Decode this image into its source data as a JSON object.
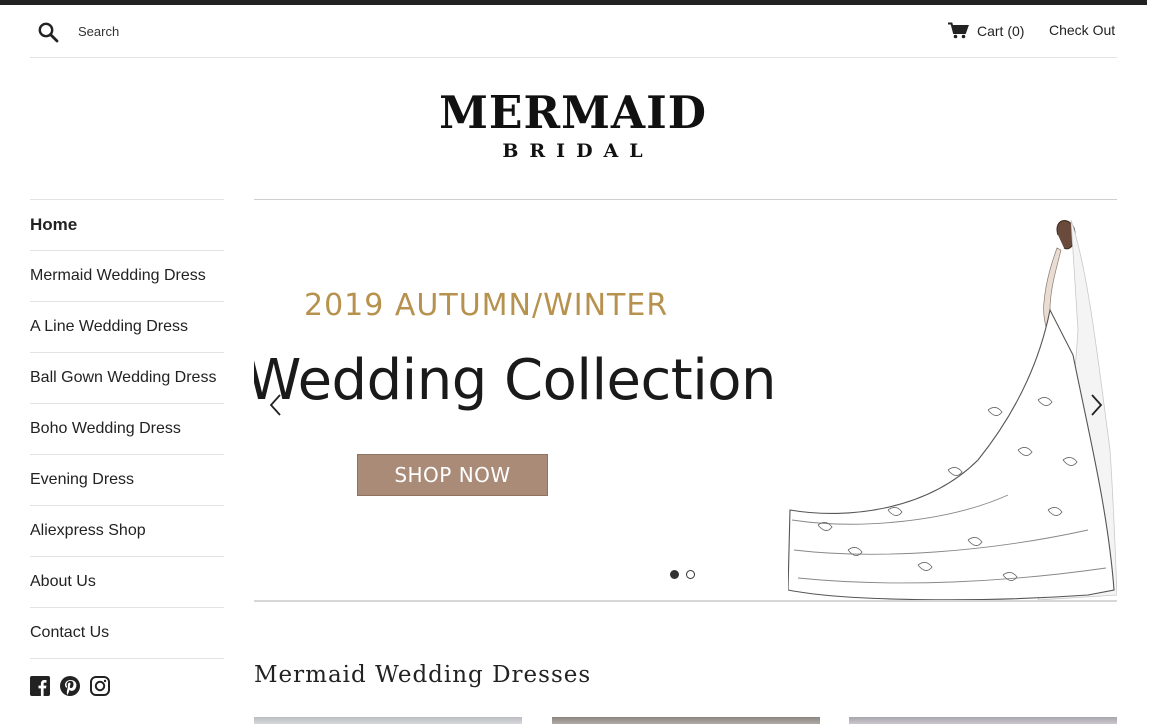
{
  "header": {
    "search_placeholder": "Search",
    "cart_label": "Cart (0)",
    "checkout_label": "Check Out"
  },
  "logo": {
    "main": "MERMAID",
    "sub": "BRIDAL"
  },
  "nav": {
    "items": [
      {
        "label": "Home",
        "active": true
      },
      {
        "label": "Mermaid Wedding Dress"
      },
      {
        "label": "A Line Wedding Dress"
      },
      {
        "label": "Ball Gown Wedding Dress"
      },
      {
        "label": "Boho Wedding Dress"
      },
      {
        "label": "Evening Dress"
      },
      {
        "label": "Aliexpress Shop"
      },
      {
        "label": "About Us"
      },
      {
        "label": "Contact Us"
      }
    ]
  },
  "social": {
    "icons": [
      "facebook-icon",
      "pinterest-icon",
      "instagram-icon"
    ]
  },
  "slider": {
    "season": "2019 AUTUMN/WINTER",
    "headline": "Wedding Collection",
    "button_label": "SHOP NOW",
    "slide_count": 2,
    "active_slide": 1
  },
  "section": {
    "title": "Mermaid Wedding Dresses"
  },
  "colors": {
    "gold_text": "#b7924e",
    "shop_button": "#a98b78",
    "dark": "#222222"
  }
}
